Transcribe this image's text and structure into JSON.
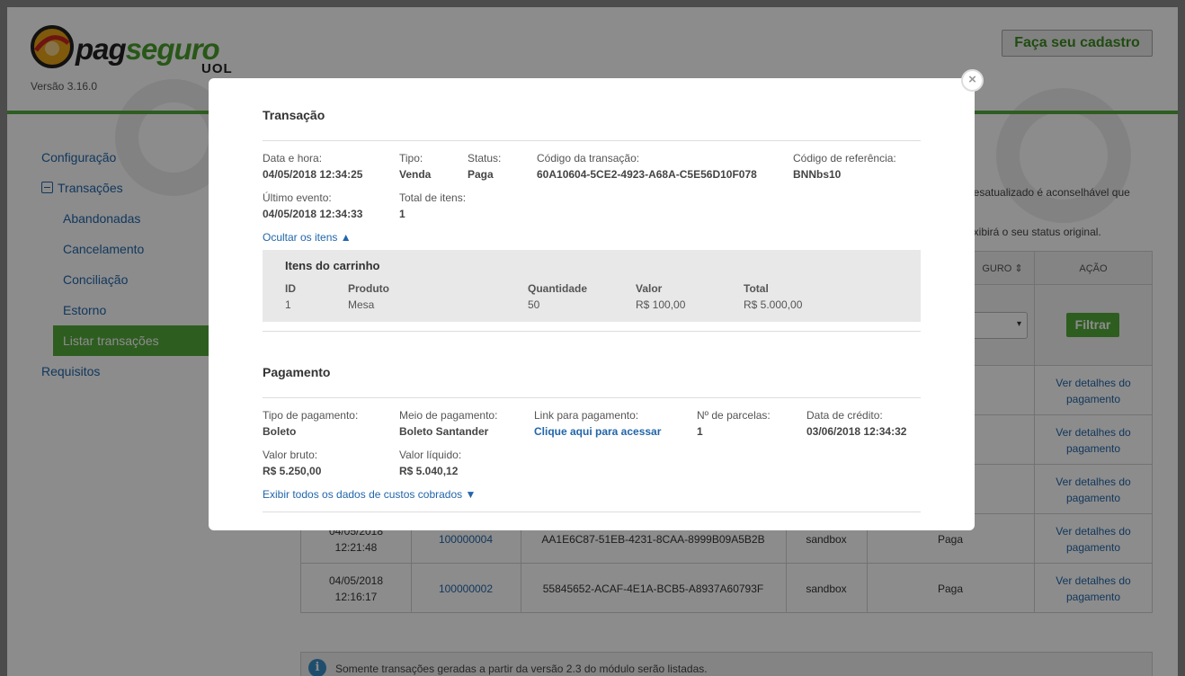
{
  "header": {
    "logo_pag": "pag",
    "logo_seguro": "seguro",
    "logo_uol": "UOL",
    "version": "Versão 3.16.0",
    "cadastro_label": "Faça seu cadastro"
  },
  "sidebar": {
    "items": [
      {
        "label": "Configuração"
      },
      {
        "label": "Transações"
      },
      {
        "label": "Abandonadas"
      },
      {
        "label": "Cancelamento"
      },
      {
        "label": "Conciliação"
      },
      {
        "label": "Estorno"
      },
      {
        "label": "Listar transações"
      },
      {
        "label": "Requisitos"
      }
    ]
  },
  "main": {
    "warn_line1": "desatualizado é aconselhável que",
    "warn_line2": "exibirá o seu status original.",
    "col_seguro": "GURO",
    "sort_icon": "⇕",
    "col_acao": "AÇÃO",
    "filter_label": "Filtrar",
    "select_arrow": "▾",
    "rows": [
      {
        "date": "",
        "time": "",
        "ref": "",
        "code": "",
        "env": "",
        "status": "",
        "action1": "Ver detalhes do",
        "action2": "pagamento"
      },
      {
        "date": "",
        "time": "",
        "ref": "",
        "code": "",
        "env": "",
        "status": "",
        "action1": "Ver detalhes do",
        "action2": "pagamento"
      },
      {
        "date": "",
        "time": "",
        "ref": "",
        "code": "",
        "env": "",
        "status": "",
        "action1": "Ver detalhes do",
        "action2": "pagamento"
      },
      {
        "date": "04/05/2018",
        "time": "12:21:48",
        "ref": "100000004",
        "code": "AA1E6C87-51EB-4231-8CAA-8999B09A5B2B",
        "env": "sandbox",
        "status": "Paga",
        "action1": "Ver detalhes do",
        "action2": "pagamento"
      },
      {
        "date": "04/05/2018",
        "time": "12:16:17",
        "ref": "100000002",
        "code": "55845652-ACAF-4E1A-BCB5-A8937A60793F",
        "env": "sandbox",
        "status": "Paga",
        "action1": "Ver detalhes do",
        "action2": "pagamento"
      }
    ],
    "info_icon": "i",
    "info_text": "Somente transações geradas a partir da versão 2.3 do módulo serão listadas."
  },
  "modal": {
    "close_glyph": "×",
    "transaction_title": "Transação",
    "fields": {
      "datetime_label": "Data e hora:",
      "datetime_value": "04/05/2018 12:34:25",
      "type_label": "Tipo:",
      "type_value": "Venda",
      "status_label": "Status:",
      "status_value": "Paga",
      "code_label": "Código da transação:",
      "code_value": "60A10604-5CE2-4923-A68A-C5E56D10F078",
      "ref_label": "Código de referência:",
      "ref_value": "BNNbs10",
      "last_event_label": "Último evento:",
      "last_event_value": "04/05/2018 12:34:33",
      "total_items_label": "Total de itens:",
      "total_items_value": "1"
    },
    "hide_items_link": "Ocultar os itens ▲",
    "cart": {
      "title": "Itens do carrinho",
      "headers": {
        "id": "ID",
        "product": "Produto",
        "qty": "Quantidade",
        "value": "Valor",
        "total": "Total"
      },
      "row": {
        "id": "1",
        "product": "Mesa",
        "qty": "50",
        "value": "R$ 100,00",
        "total": "R$ 5.000,00"
      }
    },
    "payment_title": "Pagamento",
    "payment": {
      "type_label": "Tipo de pagamento:",
      "type_value": "Boleto",
      "method_label": "Meio de pagamento:",
      "method_value": "Boleto Santander",
      "link_label": "Link para pagamento:",
      "link_value": "Clique aqui para acessar",
      "installments_label": "Nº de parcelas:",
      "installments_value": "1",
      "credit_label": "Data de crédito:",
      "credit_value": "03/06/2018 12:34:32",
      "gross_label": "Valor bruto:",
      "gross_value": "R$ 5.250,00",
      "net_label": "Valor líquido:",
      "net_value": "R$ 5.040,12"
    },
    "show_costs_link": "Exibir todos os dados de custos cobrados ▼"
  }
}
